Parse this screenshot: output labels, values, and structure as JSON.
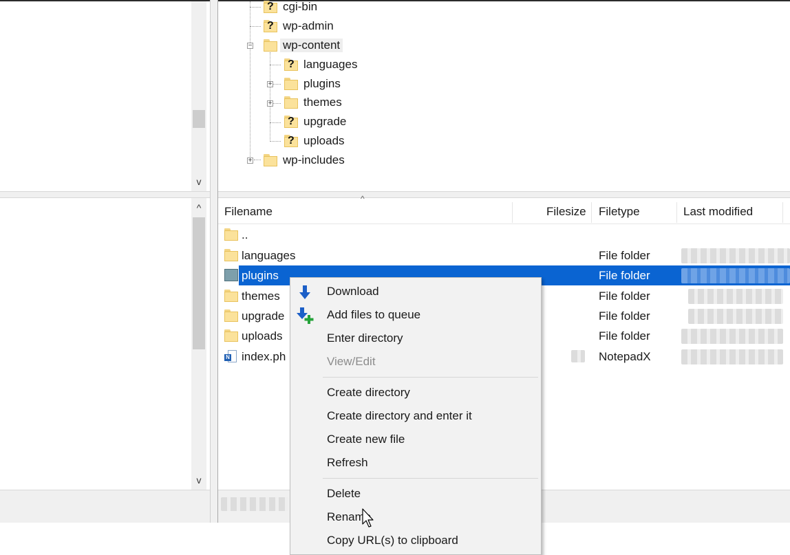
{
  "remote_tree": {
    "items": [
      {
        "label": "cgi-bin",
        "unknown": true
      },
      {
        "label": "wp-admin",
        "unknown": true
      },
      {
        "label": "wp-content",
        "expanded": true,
        "highlighted": true
      },
      {
        "label": "languages",
        "unknown": true
      },
      {
        "label": "plugins",
        "collapsed": true
      },
      {
        "label": "themes",
        "collapsed": true
      },
      {
        "label": "upgrade",
        "unknown": true
      },
      {
        "label": "uploads",
        "unknown": true
      },
      {
        "label": "wp-includes",
        "collapsed": true
      }
    ],
    "expand_symbol": "+",
    "collapse_symbol": "−",
    "unknown_symbol": "?"
  },
  "file_list": {
    "columns": {
      "filename": "Filename",
      "filesize": "Filesize",
      "filetype": "Filetype",
      "last_modified": "Last modified"
    },
    "sort_indicator": "^",
    "rows": [
      {
        "name": "..",
        "type": ""
      },
      {
        "name": "languages",
        "type": "File folder"
      },
      {
        "name": "plugins",
        "type": "File folder",
        "selected": true
      },
      {
        "name": "themes",
        "type": "File folder"
      },
      {
        "name": "upgrade",
        "type": "File folder"
      },
      {
        "name": "uploads",
        "type": "File folder"
      },
      {
        "name": "index.ph",
        "type": "NotepadX"
      }
    ]
  },
  "context_menu": {
    "items": [
      {
        "label": "Download",
        "icon": "download-arrow-icon"
      },
      {
        "label": "Add files to queue",
        "icon": "add-to-queue-icon"
      },
      {
        "label": "Enter directory"
      },
      {
        "label": "View/Edit",
        "disabled": true
      },
      {
        "label": "Create directory"
      },
      {
        "label": "Create directory and enter it"
      },
      {
        "label": "Create new file"
      },
      {
        "label": "Refresh"
      },
      {
        "label": "Delete"
      },
      {
        "label": "Rename"
      },
      {
        "label": "Copy URL(s) to clipboard"
      }
    ]
  },
  "scroll": {
    "up": "^",
    "down": "v"
  },
  "colors": {
    "selection": "#0a64d2",
    "folder": "#fbe29b",
    "menu_bg": "#f2f2f2"
  }
}
